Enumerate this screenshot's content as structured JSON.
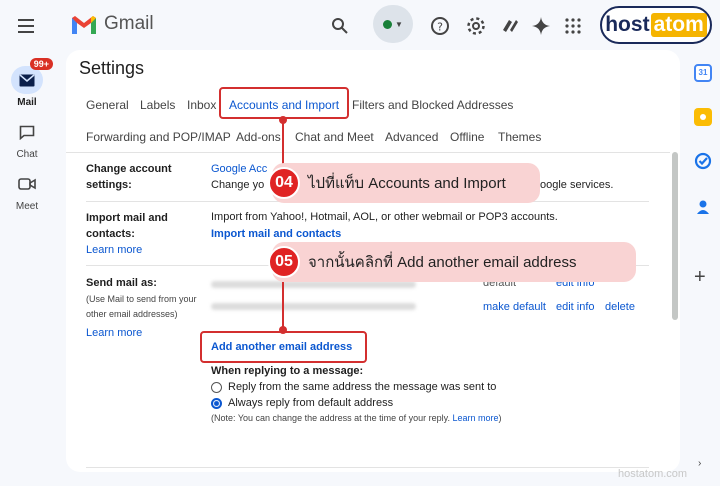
{
  "app": {
    "name": "Gmail",
    "brand_color": "#0b57d0"
  },
  "rail": [
    {
      "label": "Mail",
      "icon": "mail-icon",
      "badge": "99+"
    },
    {
      "label": "Chat",
      "icon": "chat-icon"
    },
    {
      "label": "Meet",
      "icon": "meet-icon"
    }
  ],
  "settings": {
    "title": "Settings",
    "tabs_row1": [
      "General",
      "Labels",
      "Inbox",
      "Accounts and Import",
      "Filters and Blocked Addresses"
    ],
    "tabs_row2": [
      "Forwarding and POP/IMAP",
      "Add-ons",
      "Chat and Meet",
      "Advanced",
      "Offline",
      "Themes"
    ],
    "active_tab": "Accounts and Import"
  },
  "sections": {
    "change_account": {
      "label": "Change account settings:",
      "link": "Google Acc",
      "desc_left": "Change yo",
      "desc_right": "oogle services."
    },
    "import": {
      "label": "Import mail and contacts:",
      "learn_more": "Learn more",
      "desc": "Import from Yahoo!, Hotmail, AOL, or other webmail or POP3 accounts.",
      "link": "Import mail and contacts"
    },
    "send_as": {
      "label": "Send mail as:",
      "sub": "(Use Mail to send from your other email addresses)",
      "learn_more": "Learn more",
      "row1_actions": [
        "default",
        "edit info"
      ],
      "row2_actions": [
        "make default",
        "edit info",
        "delete"
      ],
      "add_link": "Add another email address",
      "reply_heading": "When replying to a message:",
      "options": [
        "Reply from the same address the message was sent to",
        "Always reply from default address"
      ],
      "selected_option": 1,
      "note": "(Note: You can change the address at the time of your reply.",
      "note_link": "Learn more",
      "note_end": ")"
    }
  },
  "callouts": [
    {
      "step": "04",
      "text": "ไปที่แท็บ Accounts and Import"
    },
    {
      "step": "05",
      "text": "จากนั้นคลิกที่ Add another email address"
    }
  ],
  "branding": {
    "logo_part1": "host",
    "logo_part2": "atom",
    "watermark": "hostatom.com"
  },
  "colors": {
    "callout_bg": "#f9d3d3",
    "callout_accent": "#e02424",
    "highlight_border": "#d32f2f"
  }
}
